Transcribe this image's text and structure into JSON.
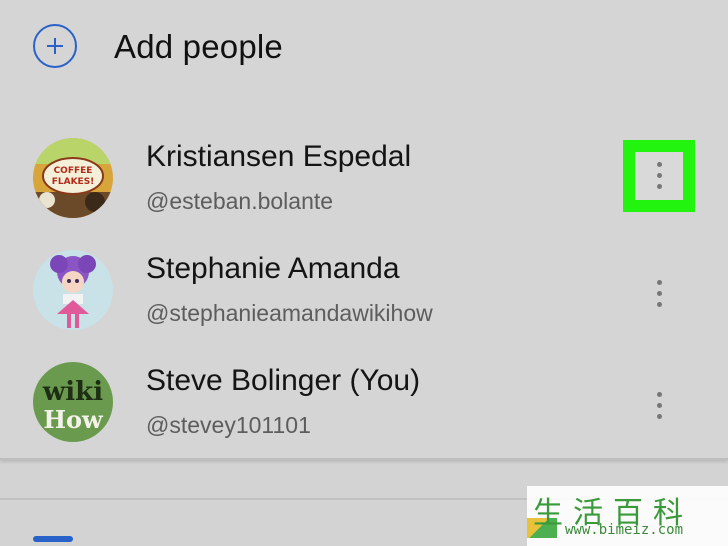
{
  "add_people": {
    "label": "Add people",
    "icon": "plus-circle-icon",
    "accent": "#2962c9"
  },
  "people": [
    {
      "name": "Kristiansen Espedal",
      "handle": "@esteban.bolante",
      "avatar": "coffee-flakes-avatar",
      "avatar_text": "COFFEE FLAKES!",
      "menu_icon": "more-vertical-icon",
      "highlighted": true
    },
    {
      "name": "Stephanie Amanda",
      "handle": "@stephanieamandawikihow",
      "avatar": "doll-avatar",
      "menu_icon": "more-vertical-icon",
      "highlighted": false
    },
    {
      "name": "Steve Bolinger (You)",
      "handle": "@stevey101101",
      "avatar": "wikihow-avatar",
      "avatar_text": "wiki How",
      "menu_icon": "more-vertical-icon",
      "highlighted": false
    }
  ],
  "highlight_color": "#22f30f",
  "watermark": {
    "chinese": "生活百科",
    "url": "www.bimeiz.com"
  }
}
